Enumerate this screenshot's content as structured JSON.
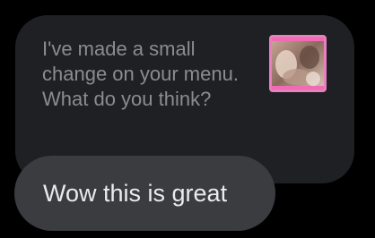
{
  "reply": {
    "text": "I've made a small change on your menu. What do you think?",
    "attachment_icon": "photo-thumbnail"
  },
  "message": {
    "text": "Wow this is great"
  },
  "colors": {
    "background": "#000000",
    "reply_bubble": "#1f2023",
    "reply_text": "#8a8c90",
    "message_bubble": "#3a3c40",
    "message_text": "#ebebec",
    "thumbnail_frame": "#e87fbe"
  }
}
